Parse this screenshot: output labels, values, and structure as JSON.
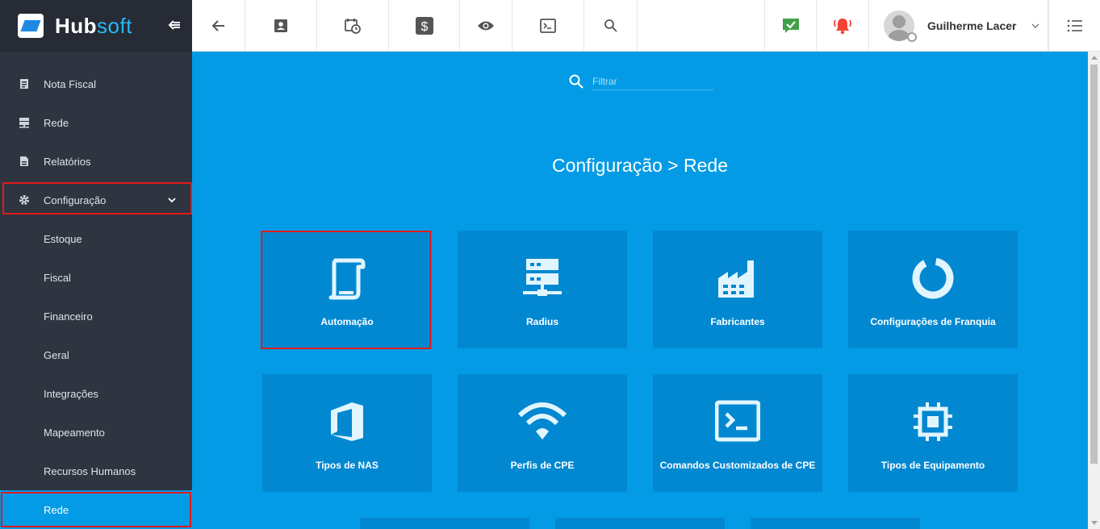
{
  "app": {
    "logo_left": "Hub",
    "logo_right": "soft"
  },
  "user": {
    "name": "Guilherme Lacer"
  },
  "sidebar": {
    "items": [
      {
        "label": "Nota Fiscal",
        "icon": "document-lines-icon"
      },
      {
        "label": "Rede",
        "icon": "network-icon"
      },
      {
        "label": "Relatórios",
        "icon": "report-icon"
      },
      {
        "label": "Configuração",
        "icon": "gear-icon"
      }
    ],
    "subitems": [
      {
        "label": "Estoque"
      },
      {
        "label": "Fiscal"
      },
      {
        "label": "Financeiro"
      },
      {
        "label": "Geral"
      },
      {
        "label": "Integrações"
      },
      {
        "label": "Mapeamento"
      },
      {
        "label": "Recursos Humanos"
      },
      {
        "label": "Rede"
      }
    ]
  },
  "filter": {
    "placeholder": "Filtrar"
  },
  "page": {
    "title": "Configuração > Rede"
  },
  "tiles": [
    {
      "label": "Automação",
      "icon": "automation-icon"
    },
    {
      "label": "Radius",
      "icon": "server-network-icon"
    },
    {
      "label": "Fabricantes",
      "icon": "factory-icon"
    },
    {
      "label": "Configurações de Franquia",
      "icon": "donut-chart-icon"
    },
    {
      "label": "Tipos de NAS",
      "icon": "office-icon"
    },
    {
      "label": "Perfis de CPE",
      "icon": "wifi-icon"
    },
    {
      "label": "Comandos Customizados de CPE",
      "icon": "terminal-icon"
    },
    {
      "label": "Tipos de Equipamento",
      "icon": "chip-icon"
    }
  ],
  "colors": {
    "sidebar_bg": "#2e3440",
    "accent": "#039be5",
    "tile_bg": "#0288d1",
    "highlight": "#e21b1b",
    "check_green": "#43a047",
    "bell_red": "#f44336"
  }
}
